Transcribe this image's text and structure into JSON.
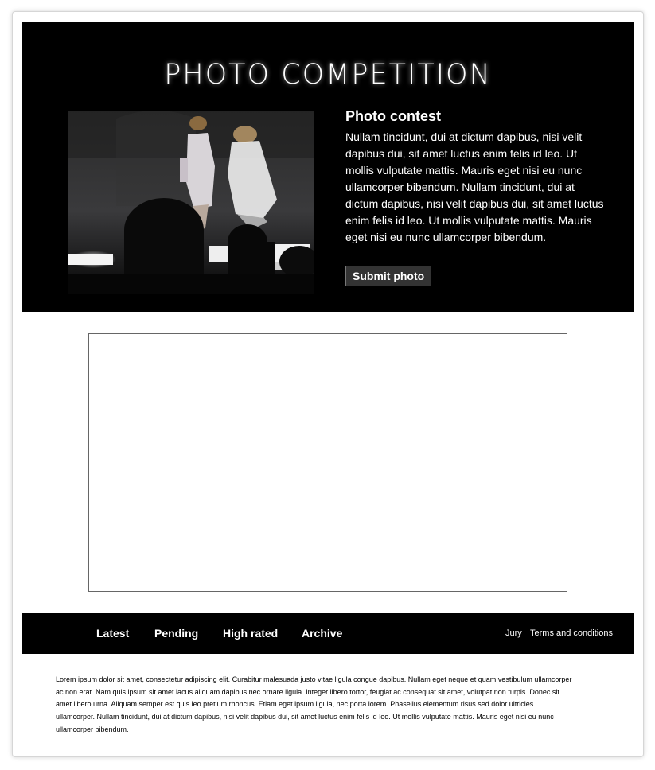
{
  "header": {
    "title": "PHOTO COMPETITION"
  },
  "hero": {
    "photo_alt": "fashion runway photo",
    "contest_title": "Photo contest",
    "contest_text": "Nullam tincidunt, dui at dictum dapibus, nisi velit dapibus dui, sit amet luctus enim felis id leo. Ut mollis vulputate mattis. Mauris eget nisi eu nunc ullamcorper bibendum. Nullam tincidunt, dui at dictum dapibus, nisi velit dapibus dui, sit amet luctus enim felis id leo. Ut mollis vulputate mattis. Mauris eget nisi eu nunc ullamcorper bibendum.",
    "submit_label": "Submit photo"
  },
  "nav": {
    "items": [
      {
        "label": "Latest"
      },
      {
        "label": "Pending"
      },
      {
        "label": "High rated"
      },
      {
        "label": "Archive"
      }
    ],
    "right_items": [
      {
        "label": "Jury"
      },
      {
        "label": "Terms and conditions"
      }
    ]
  },
  "footer": {
    "text": "Lorem ipsum dolor sit amet, consectetur adipiscing elit. Curabitur malesuada justo vitae ligula congue dapibus. Nullam eget neque et quam vestibulum ullamcorper ac non erat. Nam quis ipsum sit amet lacus aliquam dapibus nec ornare ligula. Integer libero tortor, feugiat ac consequat sit amet, volutpat non turpis. Donec sit amet libero urna. Aliquam semper est quis leo pretium rhoncus. Etiam eget ipsum ligula, nec porta lorem. Phasellus elementum risus sed dolor ultricies ullamcorper. Nullam tincidunt, dui at dictum dapibus, nisi velit dapibus dui, sit amet luctus enim felis id leo. Ut mollis vulputate mattis. Mauris eget nisi eu nunc ullamcorper bibendum."
  },
  "colors": {
    "hero_background": "#000000",
    "button_background": "#333333",
    "text_on_dark": "#ffffff"
  }
}
